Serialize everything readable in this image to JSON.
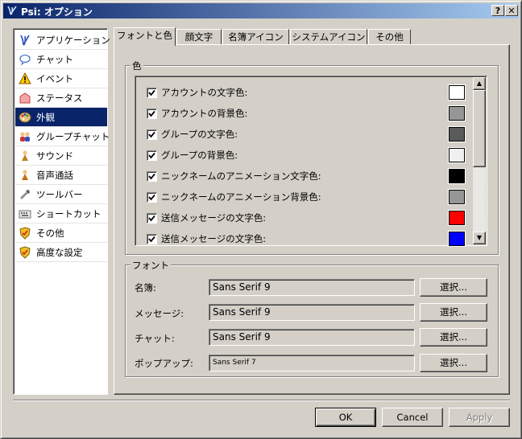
{
  "window": {
    "title": "Psi: オプション",
    "help_btn": "?",
    "close_btn": "✕"
  },
  "sidebar": {
    "items": [
      {
        "label": "アプリケーション",
        "icon": "psi-logo-icon"
      },
      {
        "label": "チャット",
        "icon": "chat-bubble-icon"
      },
      {
        "label": "イベント",
        "icon": "warning-icon"
      },
      {
        "label": "ステータス",
        "icon": "status-icon"
      },
      {
        "label": "外観",
        "icon": "palette-icon"
      },
      {
        "label": "グループチャット",
        "icon": "groupchat-icon"
      },
      {
        "label": "サウンド",
        "icon": "sound-icon"
      },
      {
        "label": "音声通話",
        "icon": "voice-call-icon"
      },
      {
        "label": "ツールバー",
        "icon": "toolbar-icon"
      },
      {
        "label": "ショートカット",
        "icon": "shortcut-icon"
      },
      {
        "label": "その他",
        "icon": "shield-icon"
      },
      {
        "label": "高度な設定",
        "icon": "shield-icon"
      }
    ],
    "selected_index": 4
  },
  "tabs": [
    {
      "label": "フォントと色"
    },
    {
      "label": "顔文字"
    },
    {
      "label": "名簿アイコン"
    },
    {
      "label": "システムアイコン"
    },
    {
      "label": "その他"
    }
  ],
  "colors_group": {
    "title": "色",
    "items": [
      {
        "label": "アカウントの文字色:",
        "checked": true,
        "color": "#ffffff"
      },
      {
        "label": "アカウントの背景色:",
        "checked": true,
        "color": "#969696"
      },
      {
        "label": "グループの文字色:",
        "checked": true,
        "color": "#5a5a5a"
      },
      {
        "label": "グループの背景色:",
        "checked": true,
        "color": "#f0f0f0"
      },
      {
        "label": "ニックネームのアニメーション文字色:",
        "checked": true,
        "color": "#000000"
      },
      {
        "label": "ニックネームのアニメーション背景色:",
        "checked": true,
        "color": "#969696"
      },
      {
        "label": "送信メッセージの文字色:",
        "checked": true,
        "color": "#ff0000"
      },
      {
        "label": "送信メッセージの文字色:",
        "checked": true,
        "color": "#0000ff"
      }
    ]
  },
  "fonts_group": {
    "title": "フォント",
    "rows": [
      {
        "label": "名簿:",
        "value": "Sans Serif 9",
        "button": "選択..."
      },
      {
        "label": "メッセージ:",
        "value": "Sans Serif 9",
        "button": "選択..."
      },
      {
        "label": "チャット:",
        "value": "Sans Serif 9",
        "button": "選択..."
      },
      {
        "label": "ポップアップ:",
        "value": "Sans Serif 7",
        "button": "選択..."
      }
    ]
  },
  "footer": {
    "ok": "OK",
    "cancel": "Cancel",
    "apply": "Apply"
  }
}
